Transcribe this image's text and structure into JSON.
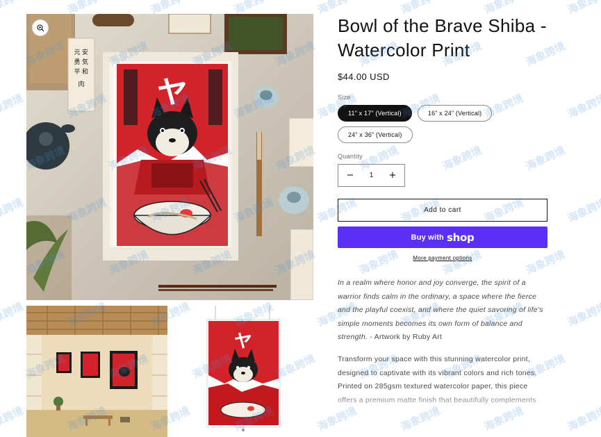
{
  "product": {
    "title": "Bowl of the Brave Shiba - Watercolor Print",
    "price": "$44.00 USD"
  },
  "size": {
    "label": "Size",
    "options": [
      "11” x 17” (Vertical)",
      "16” x 24” (Vertical)",
      "24” x 36” (Vertical)"
    ],
    "selected_index": 0
  },
  "quantity": {
    "label": "Quantity",
    "value": "1",
    "decrease": "−",
    "increase": "+"
  },
  "actions": {
    "add_to_cart": "Add to cart",
    "buy_with": "Buy with",
    "shop": "shop",
    "more_payment": "More payment options"
  },
  "description": {
    "quote": "In a realm where honor and joy converge, the spirit of a warrior finds calm in the ordinary, a space where the fierce and the playful coexist, and where the quiet savoring of life’s simple moments becomes its own form of balance and strength.",
    "credit": " - Artwork by Ruby Art",
    "body": "Transform your space with this stunning watercolor print, designed to captivate with its vibrant colors and rich tones. Printed on 285gsm textured watercolor paper, this piece offers a premium matte finish that beautifully complements"
  },
  "artwork": {
    "glyph": "ヤ",
    "scroll_text": "空 勇 気 平 和"
  },
  "watermark_text": "海象跨境",
  "icons": {
    "zoom": "zoom-icon",
    "minus": "minus-icon",
    "plus": "plus-icon"
  },
  "colors": {
    "accent": "#5a31f4",
    "selected_pill": "#121212",
    "art_red": "#d2232a"
  }
}
